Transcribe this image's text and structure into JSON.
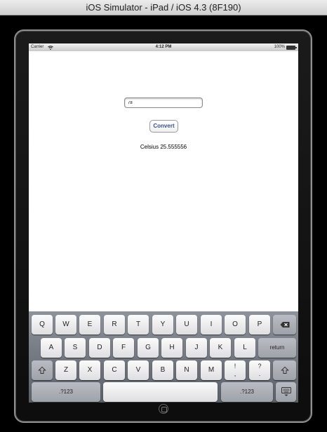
{
  "window": {
    "title": "iOS Simulator - iPad / iOS 4.3 (8F190)"
  },
  "status_bar": {
    "carrier": "Carrier",
    "time": "4:12 PM",
    "battery": "100%"
  },
  "app": {
    "input_value": "78",
    "convert_label": "Convert",
    "result_text": "Celsius 25.555556"
  },
  "keyboard": {
    "row1": [
      "Q",
      "W",
      "E",
      "R",
      "T",
      "Y",
      "U",
      "I",
      "O",
      "P"
    ],
    "row2": [
      "A",
      "S",
      "D",
      "F",
      "G",
      "H",
      "J",
      "K",
      "L"
    ],
    "row2_return": "return",
    "row3": [
      "Z",
      "X",
      "C",
      "V",
      "B",
      "N",
      "M"
    ],
    "row3_punct": [
      [
        "!",
        ","
      ],
      [
        "?",
        "."
      ]
    ],
    "numbers_label": ".?123",
    "numbers_label_right": ".?123"
  },
  "icons": {
    "wifi": "wifi-icon",
    "battery": "battery-icon",
    "backspace": "backspace-icon",
    "shift": "shift-icon",
    "dismiss_keyboard": "keyboard-dismiss-icon",
    "home": "home-button-icon"
  }
}
